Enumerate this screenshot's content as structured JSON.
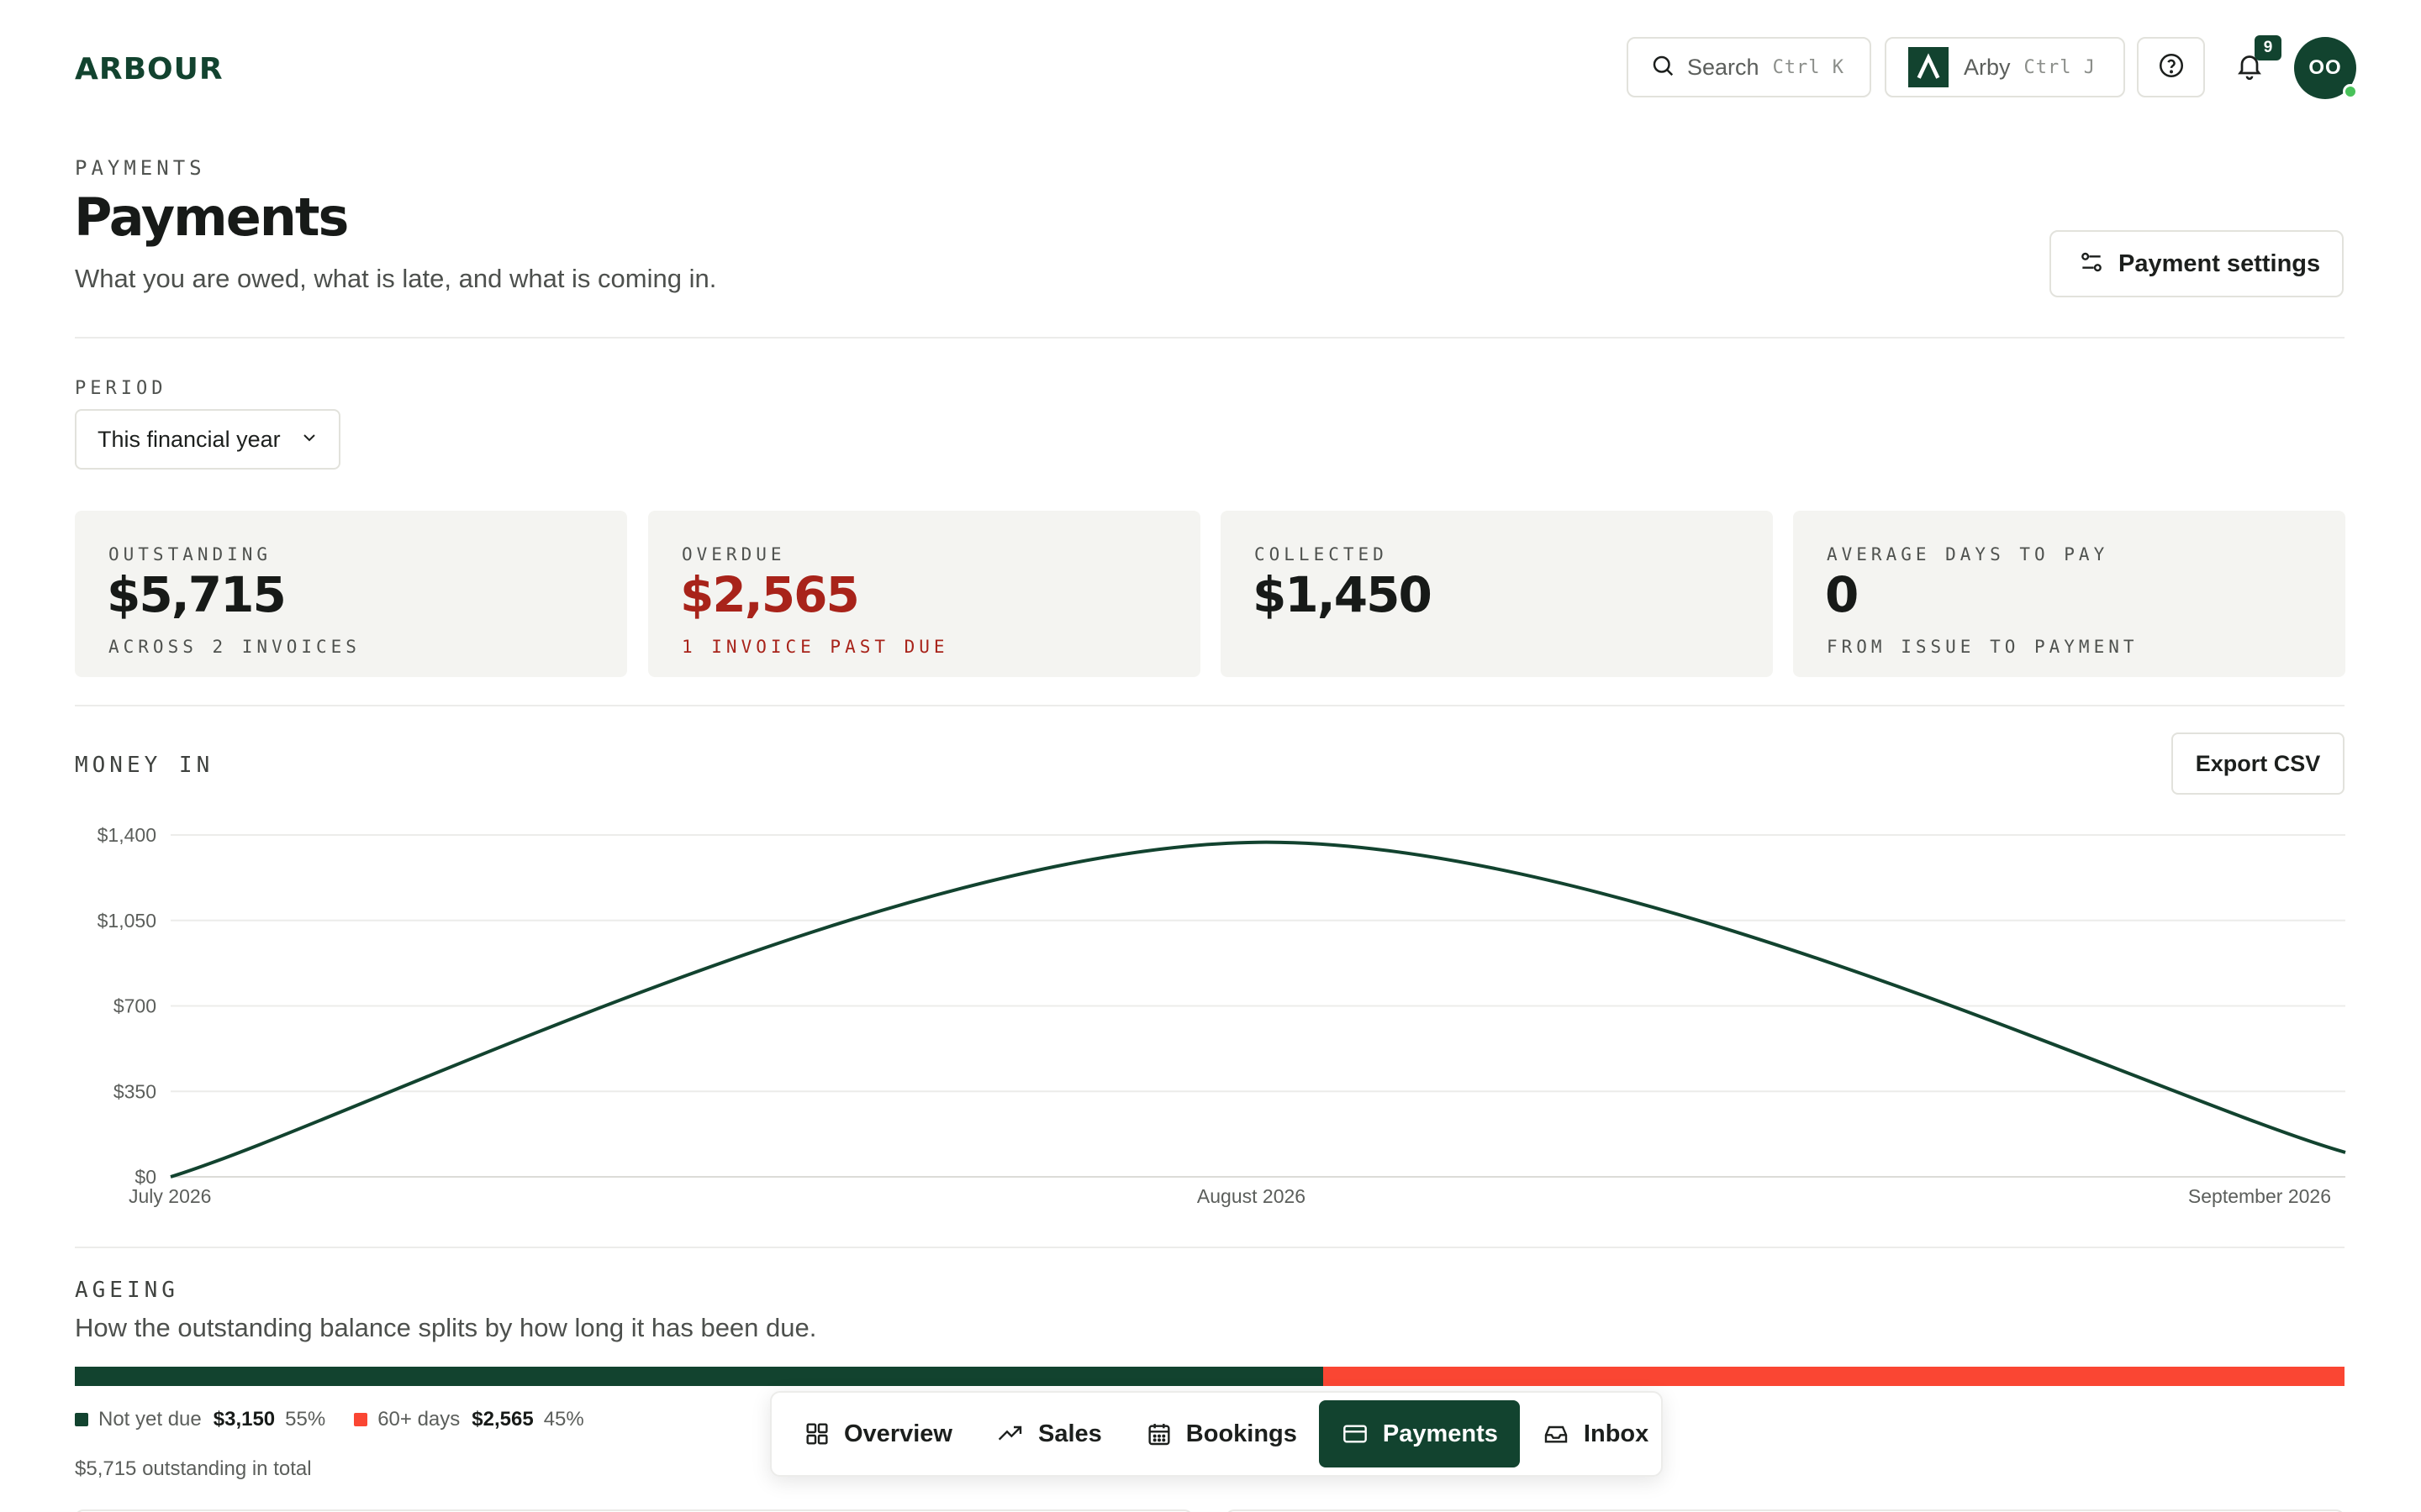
{
  "app": {
    "logo_text": "ARBOUR",
    "search_label": "Search",
    "search_shortcut": "Ctrl K",
    "assistant_label": "Arby",
    "assistant_shortcut": "Ctrl J",
    "notification_count": "9",
    "avatar_initials": "OO"
  },
  "header": {
    "breadcrumb": "PAYMENTS",
    "title": "Payments",
    "subtitle": "What you are owed, what is late, and what is coming in.",
    "settings_button": "Payment settings"
  },
  "period": {
    "label": "PERIOD",
    "selected": "This financial year"
  },
  "kpis": [
    {
      "label": "OUTSTANDING",
      "value": "$5,715",
      "sub": "ACROSS 2 INVOICES"
    },
    {
      "label": "OVERDUE",
      "value": "$2,565",
      "sub": "1 INVOICE PAST DUE"
    },
    {
      "label": "COLLECTED",
      "value": "$1,450",
      "sub": ""
    },
    {
      "label": "AVERAGE DAYS TO PAY",
      "value": "0",
      "sub": "FROM ISSUE TO PAYMENT"
    }
  ],
  "money_in": {
    "label": "MONEY IN",
    "export_button": "Export CSV"
  },
  "chart_data": {
    "type": "line",
    "title": "",
    "xlabel": "",
    "ylabel": "",
    "x": [
      "July 2026",
      "August 2026",
      "September 2026"
    ],
    "values": [
      0,
      1370,
      100
    ],
    "y_ticks": [
      "$0",
      "$350",
      "$700",
      "$1,050",
      "$1,400"
    ],
    "ylim": [
      0,
      1400
    ],
    "grid": true,
    "line_color": "#12432f"
  },
  "ageing": {
    "label": "AGEING",
    "description": "How the outstanding balance splits by how long it has been due.",
    "segments": [
      {
        "label": "Not yet due",
        "amount": "$3,150",
        "percent": "55%",
        "share": 0.55,
        "color": "#12432f"
      },
      {
        "label": "60+ days",
        "amount": "$2,565",
        "percent": "45%",
        "share": 0.45,
        "color": "#fa4633"
      }
    ],
    "total_text": "$5,715 outstanding in total"
  },
  "nav": {
    "items": [
      {
        "label": "Overview",
        "icon": "grid-icon"
      },
      {
        "label": "Sales",
        "icon": "trend-icon"
      },
      {
        "label": "Bookings",
        "icon": "calendar-icon"
      },
      {
        "label": "Payments",
        "icon": "card-icon",
        "active": true
      },
      {
        "label": "Inbox",
        "icon": "inbox-icon"
      }
    ]
  }
}
